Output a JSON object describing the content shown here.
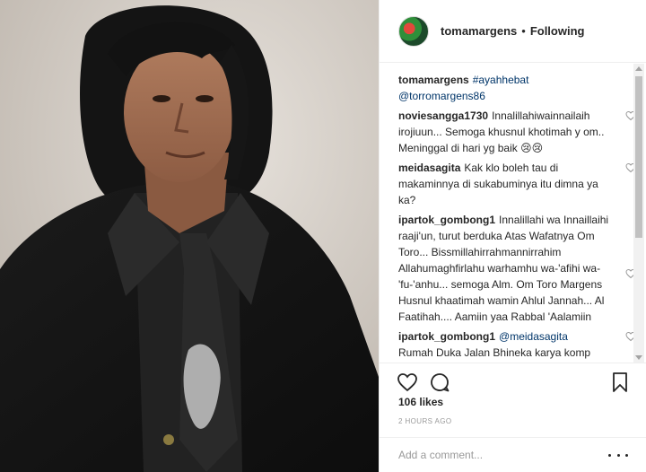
{
  "header": {
    "username": "tomamargens",
    "separator": "•",
    "follow_status": "Following"
  },
  "comments": [
    {
      "user": "tomamargens",
      "text": "",
      "tags": [
        "#ayahhebat",
        "@torromargens86"
      ],
      "likeable": false
    },
    {
      "user": "noviesangga1730",
      "text": "Innalillahiwainnailaih irojiuun... Semoga khusnul khotimah y om.. Meninggal di hari yg baik 😢😢",
      "likeable": true
    },
    {
      "user": "meidasagita",
      "text": "Kak klo boleh tau di makaminnya di sukabuminya itu dimna ya ka?",
      "likeable": true
    },
    {
      "user": "ipartok_gombong1",
      "text": "Innalillahi wa Innaillaihi raaji'un, turut berduka Atas Wafatnya Om Toro... Bissmillahirrahmannirrahim Allahumaghfirlahu warhamhu wa-'afihi wa-'fu-'anhu... semoga Alm. Om Toro Margens Husnul khaatimah wamin Ahlul Jannah... Al Faatihah.... Aamiin yaa Rabbal 'Aalamiin",
      "likeable": true
    },
    {
      "user": "ipartok_gombong1",
      "tag": "@meidasagita",
      "text": "Rumah Duka Jalan Bhineka karya komp",
      "likeable": true
    }
  ],
  "likes": "106 likes",
  "time": "2 HOURS AGO",
  "add_comment": {
    "placeholder": "Add a comment..."
  },
  "icons": {
    "like": "heart-icon",
    "comment": "comment-bubble-icon",
    "save": "bookmark-icon",
    "more": "more-options-icon"
  },
  "colors": {
    "link": "#003569",
    "text": "#262626",
    "muted": "#999999",
    "border": "#efefef"
  }
}
